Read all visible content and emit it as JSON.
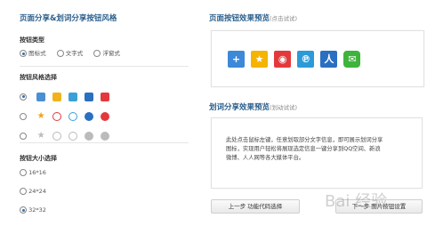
{
  "left": {
    "title_main": "页面分享&划词分享按钮风格",
    "type_label": "按钮类型",
    "type_options": [
      "图标式",
      "文字式",
      "浮窗式"
    ],
    "style_label": "按钮风格选择",
    "size_label": "按钮大小选择",
    "size_options": [
      "16*16",
      "24*24",
      "32*32"
    ]
  },
  "right": {
    "preview_title": "页面按钮效果预览",
    "preview_sub": "(点击试试)",
    "word_title": "划词分享效果预览",
    "word_sub": "(划动试试)",
    "desc_lines": [
      "此处点击鼠标左键，任意划取部分文字信息，即可展示划词分享",
      "图标，实现用户轻松将展现选定信息一键分享到QQ空间、新浪",
      "微博、人人网等各大媒体平台。"
    ],
    "prev_button": "上一步 功能代码选择",
    "next_button": "下一步 图片按钮设置"
  },
  "watermark": "Bai 经验",
  "colors": {
    "accent": "#2b5f8c",
    "radio": "#3a6ea5"
  },
  "icons_preview": [
    "plus-icon",
    "qzone-star-icon",
    "weibo-icon",
    "tencent-weibo-icon",
    "renren-icon",
    "wechat-icon"
  ]
}
